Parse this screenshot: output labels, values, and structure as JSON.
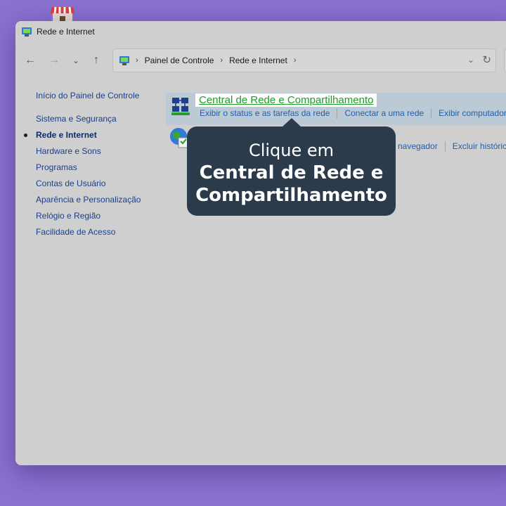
{
  "desktop": {
    "icon": "store-icon"
  },
  "window": {
    "title": "Rede e Internet",
    "colors": {
      "background": "#cfcfcf",
      "accent": "#1f5fae",
      "desktop": "#8a72d1"
    }
  },
  "toolbar": {
    "back_icon": "arrow-left-icon",
    "forward_icon": "arrow-right-icon",
    "recent_icon": "chevron-down-icon",
    "up_icon": "arrow-up-icon",
    "breadcrumbs": [
      "Painel de Controle",
      "Rede e Internet"
    ],
    "refresh_icon": "refresh-icon"
  },
  "sidebar": {
    "items": [
      {
        "label": "Início do Painel de Controle",
        "active": false
      },
      {
        "label": "Sistema e Segurança",
        "active": false
      },
      {
        "label": "Rede e Internet",
        "active": true
      },
      {
        "label": "Hardware e Sons",
        "active": false
      },
      {
        "label": "Programas",
        "active": false
      },
      {
        "label": "Contas de Usuário",
        "active": false
      },
      {
        "label": "Aparência e Personalização",
        "active": false
      },
      {
        "label": "Relógio e Região",
        "active": false
      },
      {
        "label": "Facilidade de Acesso",
        "active": false
      }
    ]
  },
  "categories": {
    "network": {
      "title": "Central de Rede e Compartilhamento",
      "links": [
        "Exibir o status e as tarefas da rede",
        "Conectar a uma rede",
        "Exibir computadores"
      ]
    },
    "internet": {
      "links": [
        "navegador",
        "Excluir históric"
      ]
    }
  },
  "tooltip": {
    "line1": "Clique em",
    "line2": "Central de Rede e",
    "line3": "Compartilhamento"
  }
}
